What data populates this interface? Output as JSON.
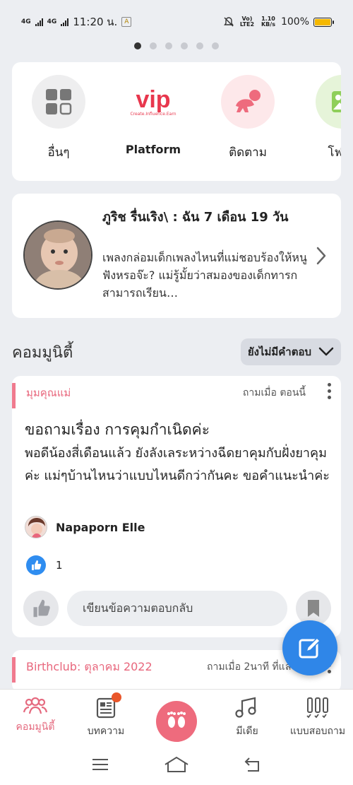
{
  "status_bar": {
    "network_1": "4G",
    "network_2": "4G",
    "time": "11:20 น.",
    "volte": "Vo) LTE2",
    "speed": "1.10 KB/s",
    "battery": "100%"
  },
  "carousel": {
    "page_count": 6,
    "active_index": 0
  },
  "shortcuts": [
    {
      "label": "อื่นๆ",
      "icon": "grid-icon"
    },
    {
      "label": "Platform",
      "icon": "vip-logo",
      "logo_text": "vip",
      "logo_subtext": "Create.Influence.Earn"
    },
    {
      "label": "ติดตาม",
      "icon": "baby-crawl-icon"
    },
    {
      "label": "โฟโต",
      "icon": "photo-icon"
    }
  ],
  "story": {
    "title": "ภูริช รื่นเริง\\ : ฉัน 7  เดือน 19 วัน",
    "description": "เพลงกล่อมเด็กเพลงไหนที่แม่ชอบร้องให้หนูฟังหรอจ๊ะ? แม่รู้มั้ยว่าสมองของเด็กทารกสามารถเรียน…"
  },
  "community": {
    "heading": "คอมมูนิตี้",
    "filter_label": "ยังไม่มีคำตอบ"
  },
  "post": {
    "category": "มุมคุณแม่",
    "time": "ถามเมื่อ ตอนนี้",
    "title": "ขอถามเรื่อง การคุมกำเนิดค่ะ",
    "body": "พอดีน้องสี่เดือนแล้ว ยังลังเลระหว่างฉีดยาคุมกับฝั่งยาคุมค่ะ แม่ๆบ้านไหนว่าแบบไหนดีกว่ากันคะ ขอคำแนะนำค่ะ",
    "author": "Napaporn Elle",
    "like_count": "1",
    "reply_placeholder": "เขียนข้อความตอบกลับ"
  },
  "post2": {
    "category": "Birthclub: ตุลาคม 2022",
    "time": "ถามเมื่อ 2นาที ที่แล้ว"
  },
  "tabs": [
    {
      "label": "คอมมูนิตี้",
      "icon": "people-icon",
      "active": true
    },
    {
      "label": "บทความ",
      "icon": "article-icon",
      "badge": true
    },
    {
      "label": "",
      "icon": "footprints-icon"
    },
    {
      "label": "มีเดีย",
      "icon": "music-icon"
    },
    {
      "label": "แบบสอบถาม",
      "icon": "poll-icon"
    }
  ],
  "colors": {
    "accent_pink": "#ee6b7d",
    "fab_blue": "#2f86e8",
    "background": "#eceef2"
  }
}
